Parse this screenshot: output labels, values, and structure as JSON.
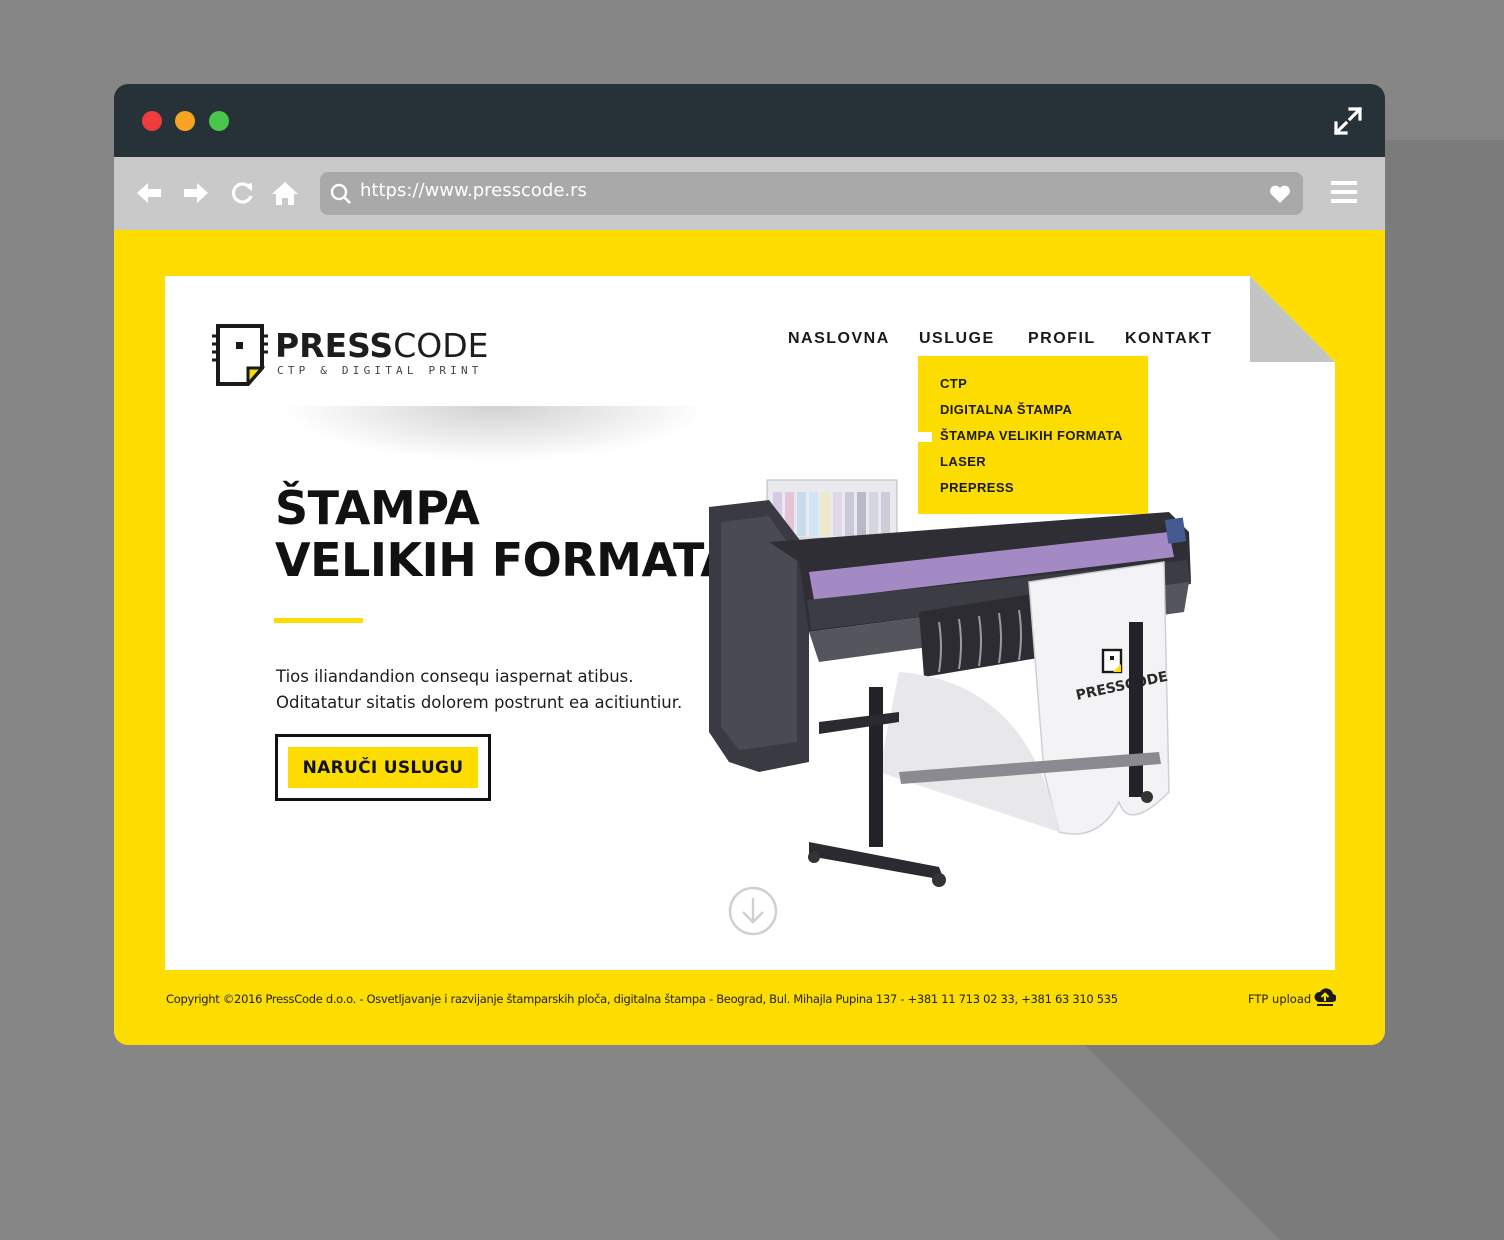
{
  "browser": {
    "url": "https://www.presscode.rs",
    "icons": [
      "back-arrow-icon",
      "forward-arrow-icon",
      "reload-icon",
      "home-icon",
      "search-icon",
      "heart-icon",
      "hamburger-menu-icon",
      "expand-icon"
    ]
  },
  "site": {
    "brand_bold": "PRESS",
    "brand_light": "CODE",
    "tagline": "CTP & DIGITAL PRINT",
    "nav": [
      "NASLOVNA",
      "USLUGE",
      "PROFIL",
      "KONTAKT"
    ],
    "dropdown": [
      "CTP",
      "DIGITALNA ŠTAMPA",
      "ŠTAMPA VELIKIH FORMATA",
      "LASER",
      "PREPRESS"
    ],
    "hero": {
      "title_line1": "ŠTAMPA",
      "title_line2": "VELIKIH FORMATA",
      "text_line1": "Tios iliandandion consequ iaspernat atibus.",
      "text_line2": "Oditatatur sitatis dolorem postrunt ea acitiuntiur.",
      "cta": "NARUČI USLUGU",
      "banner_brand": "PRESSCODE"
    },
    "footer": {
      "copyright": "Copyright ©2016 PressCode d.o.o. - Osvetljavanje i razvijanje štamparskih ploča, digitalna štampa - Beograd, Bul. Mihajla Pupina 137 - +381 11 713 02 33, +381 63 310 535",
      "ftp": "FTP upload"
    }
  },
  "colors": {
    "accent": "#fddd00",
    "titlebar": "#263238",
    "toolbar": "#c9c9c9",
    "address": "#a9a9a9",
    "backdrop": "#868686"
  }
}
